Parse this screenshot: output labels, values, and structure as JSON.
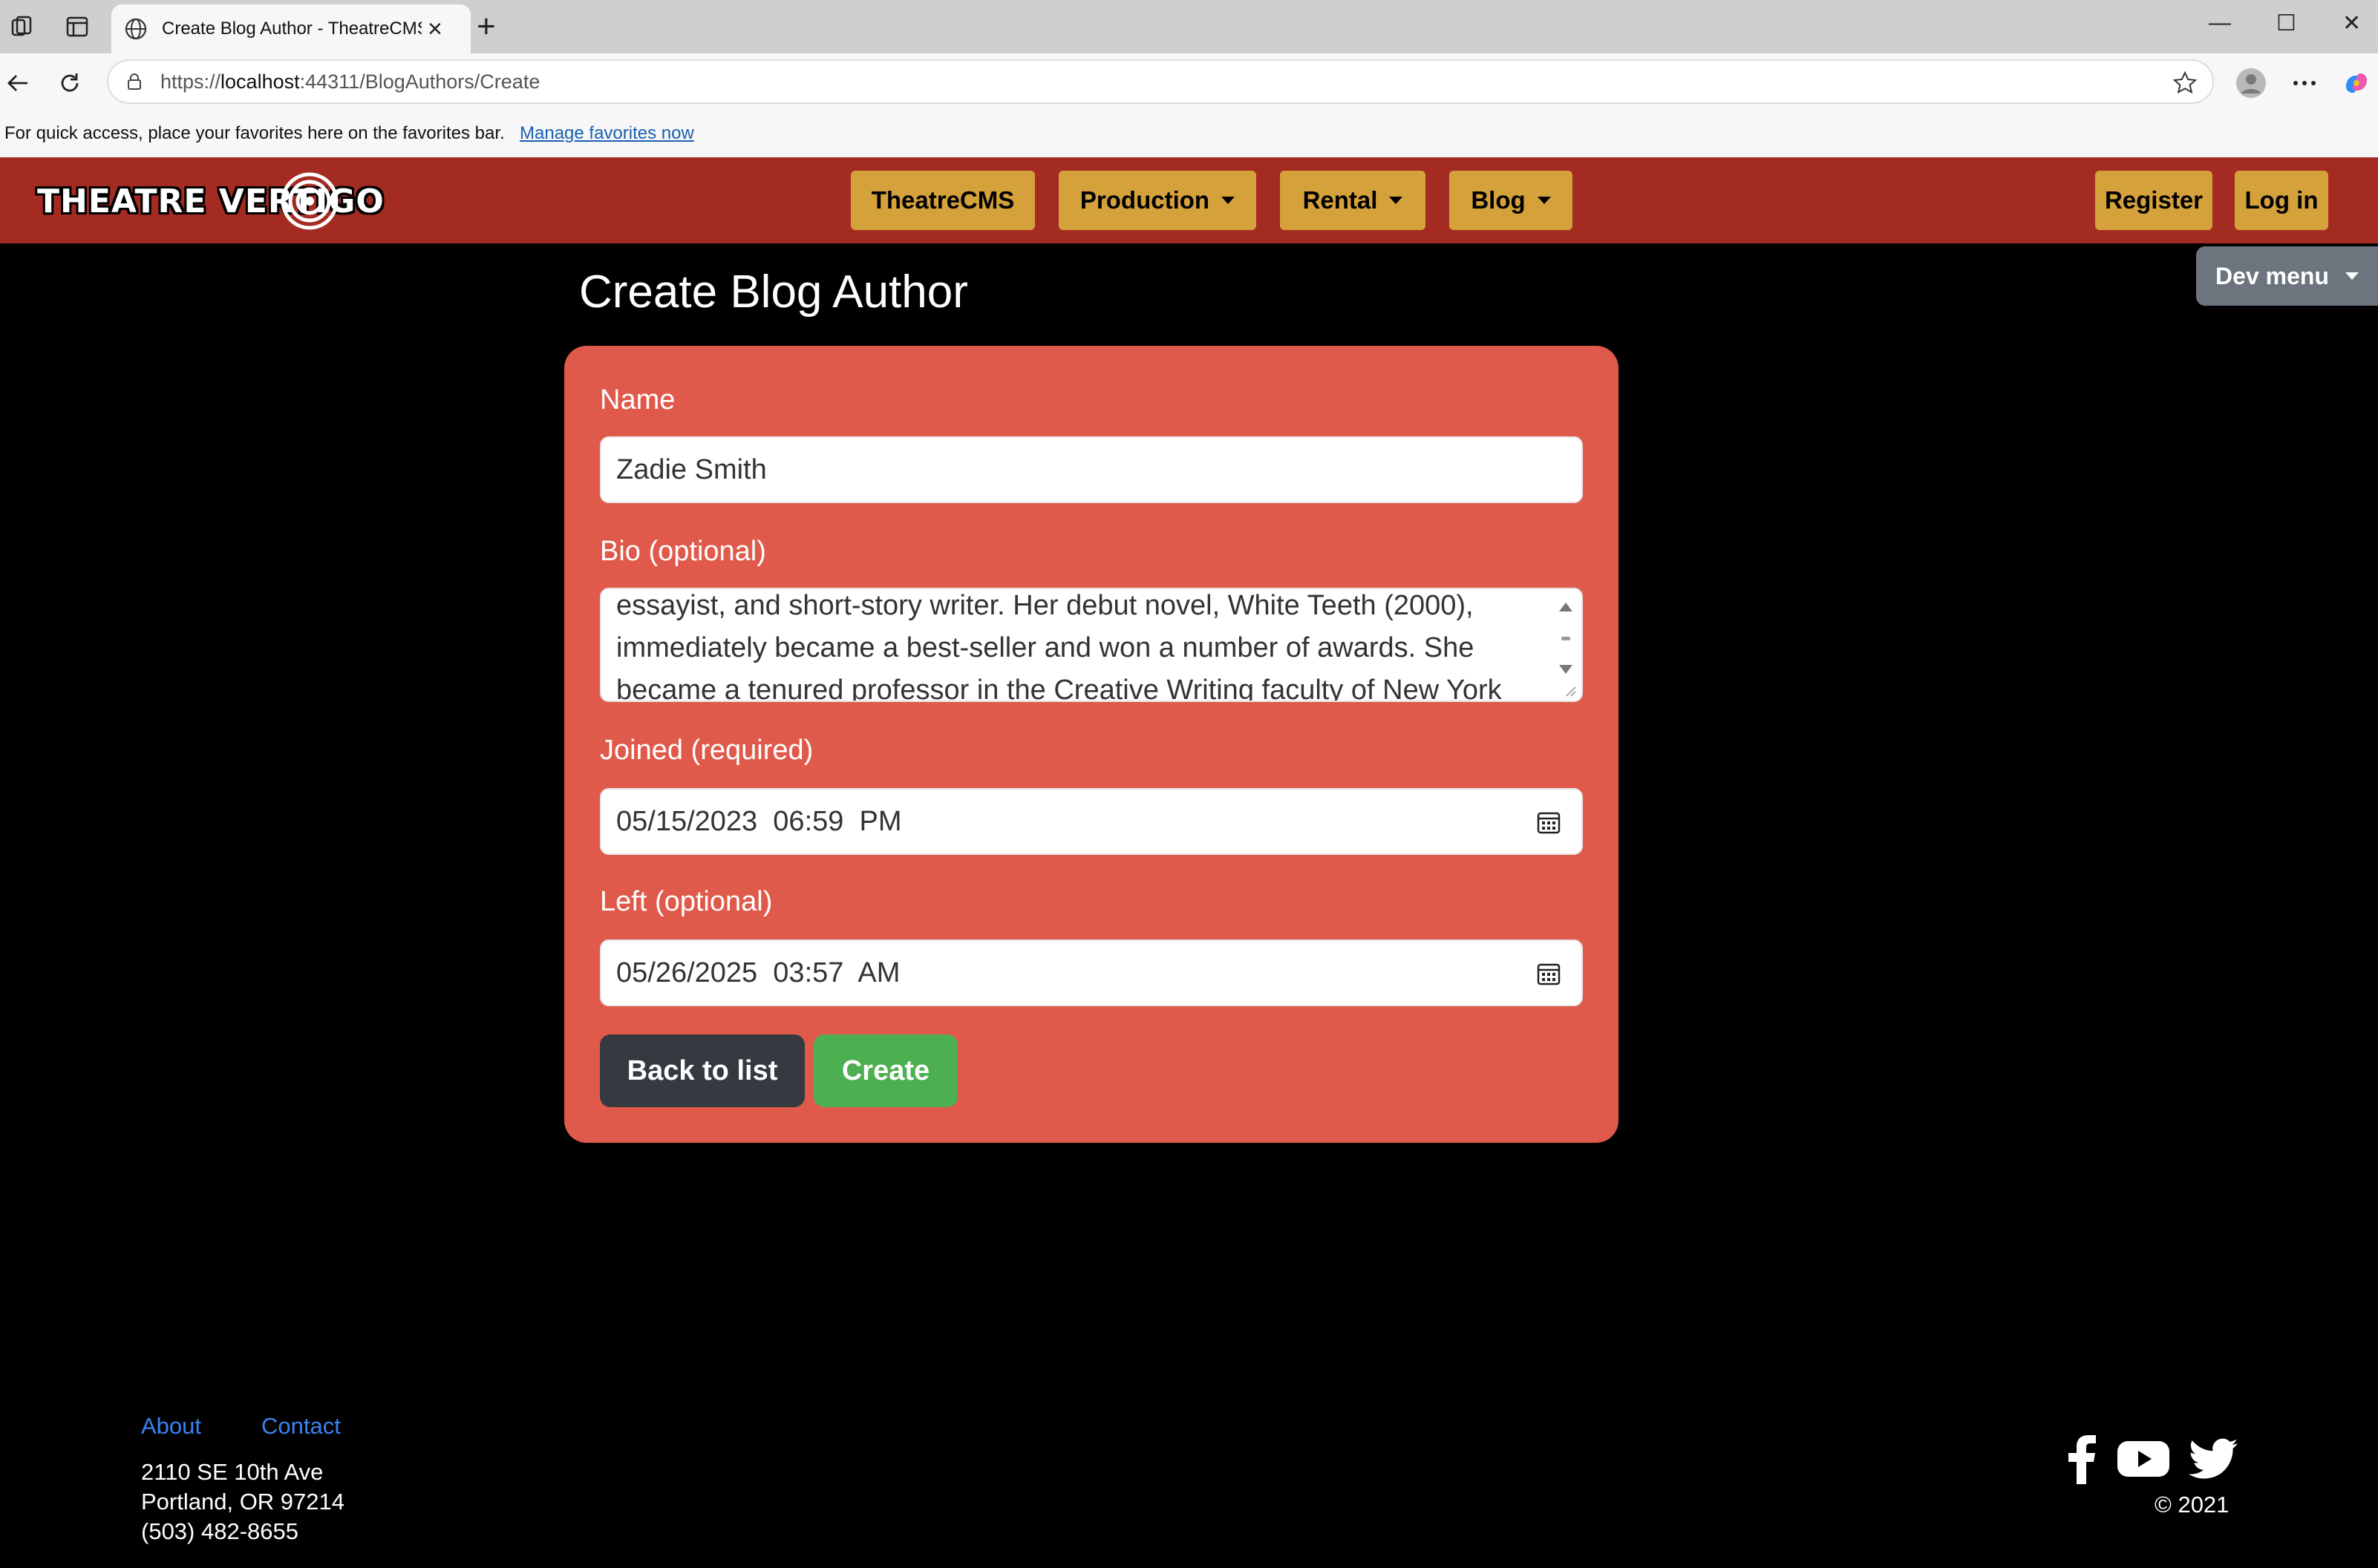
{
  "browser": {
    "tab_title": "Create Blog Author - TheatreCMS",
    "tab_close": "×",
    "new_tab": "+",
    "url_prefix": "https://",
    "url_host": "localhost",
    "url_rest": ":44311/BlogAuthors/Create",
    "favorites_text": "For quick access, place your favorites here on the favorites bar.",
    "favorites_link": "Manage favorites now",
    "window_controls": {
      "minimize": "—",
      "maximize": "☐",
      "close": "✕"
    }
  },
  "navbar": {
    "logo_text": "THEATRE VERTIGO",
    "items": [
      {
        "label": "TheatreCMS",
        "dropdown": false
      },
      {
        "label": "Production",
        "dropdown": true
      },
      {
        "label": "Rental",
        "dropdown": true
      },
      {
        "label": "Blog",
        "dropdown": true
      }
    ],
    "register": "Register",
    "login": "Log in",
    "dev_menu": "Dev menu",
    "colors": {
      "bar": "#a42b22",
      "button": "#d5a13b"
    }
  },
  "page": {
    "title": "Create Blog Author"
  },
  "form": {
    "name_label": "Name",
    "name_value": "Zadie Smith",
    "bio_label": "Bio (optional)",
    "bio_lines": [
      "essayist, and short-story writer. Her debut novel, White Teeth (2000),",
      "immediately became a best-seller and won a number of awards. She",
      "became a tenured professor in the Creative Writing faculty of New York"
    ],
    "joined_label": "Joined (required)",
    "joined_value": "05/15/2023  06:59  PM",
    "left_label": "Left (optional)",
    "left_value": "05/26/2025  03:57  AM",
    "back_button": "Back to list",
    "create_button": "Create",
    "colors": {
      "card": "#e05a4b",
      "back": "#343a40",
      "create": "#4caf50"
    }
  },
  "footer": {
    "about": "About",
    "contact": "Contact",
    "address_lines": [
      "2110 SE 10th Ave",
      "Portland, OR 97214",
      "(503) 482-8655"
    ],
    "copyright": "© 2021",
    "social_icons": [
      "facebook-icon",
      "youtube-icon",
      "twitter-icon"
    ]
  }
}
